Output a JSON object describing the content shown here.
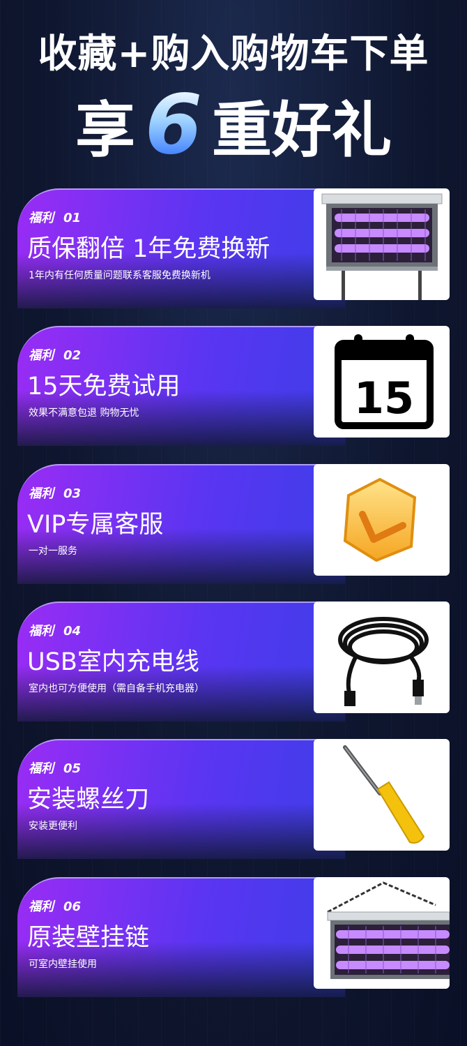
{
  "header": {
    "title_line1": "收藏+购入购物车下单",
    "title_pre": "享",
    "title_num": "6",
    "title_post": "重好礼"
  },
  "benefits": [
    {
      "tag": "福利",
      "num": "01",
      "title": "质保翻倍 1年免费换新",
      "desc": "1年内有任何质量问题联系客服免费换新机",
      "icon": "bug-zapper-stand-icon"
    },
    {
      "tag": "福利",
      "num": "02",
      "title": "15天免费试用",
      "desc": "效果不满意包退 购物无忧",
      "icon": "calendar-15-icon",
      "calendar_day": "15"
    },
    {
      "tag": "福利",
      "num": "03",
      "title": "VIP专属客服",
      "desc": "一对一服务",
      "icon": "vip-badge-icon"
    },
    {
      "tag": "福利",
      "num": "04",
      "title": "USB室内充电线",
      "desc": "室内也可方便使用（需自备手机充电器）",
      "icon": "usb-cable-icon"
    },
    {
      "tag": "福利",
      "num": "05",
      "title": "安装螺丝刀",
      "desc": "安装更便利",
      "icon": "screwdriver-icon"
    },
    {
      "tag": "福利",
      "num": "06",
      "title": "原装壁挂链",
      "desc": "可室内壁挂使用",
      "icon": "wall-chain-lamp-icon"
    }
  ],
  "colors": {
    "background": "#0f1730",
    "band_start": "#9a2cf4",
    "band_end": "#3c3fe8",
    "uv_light": "#b26cff"
  }
}
